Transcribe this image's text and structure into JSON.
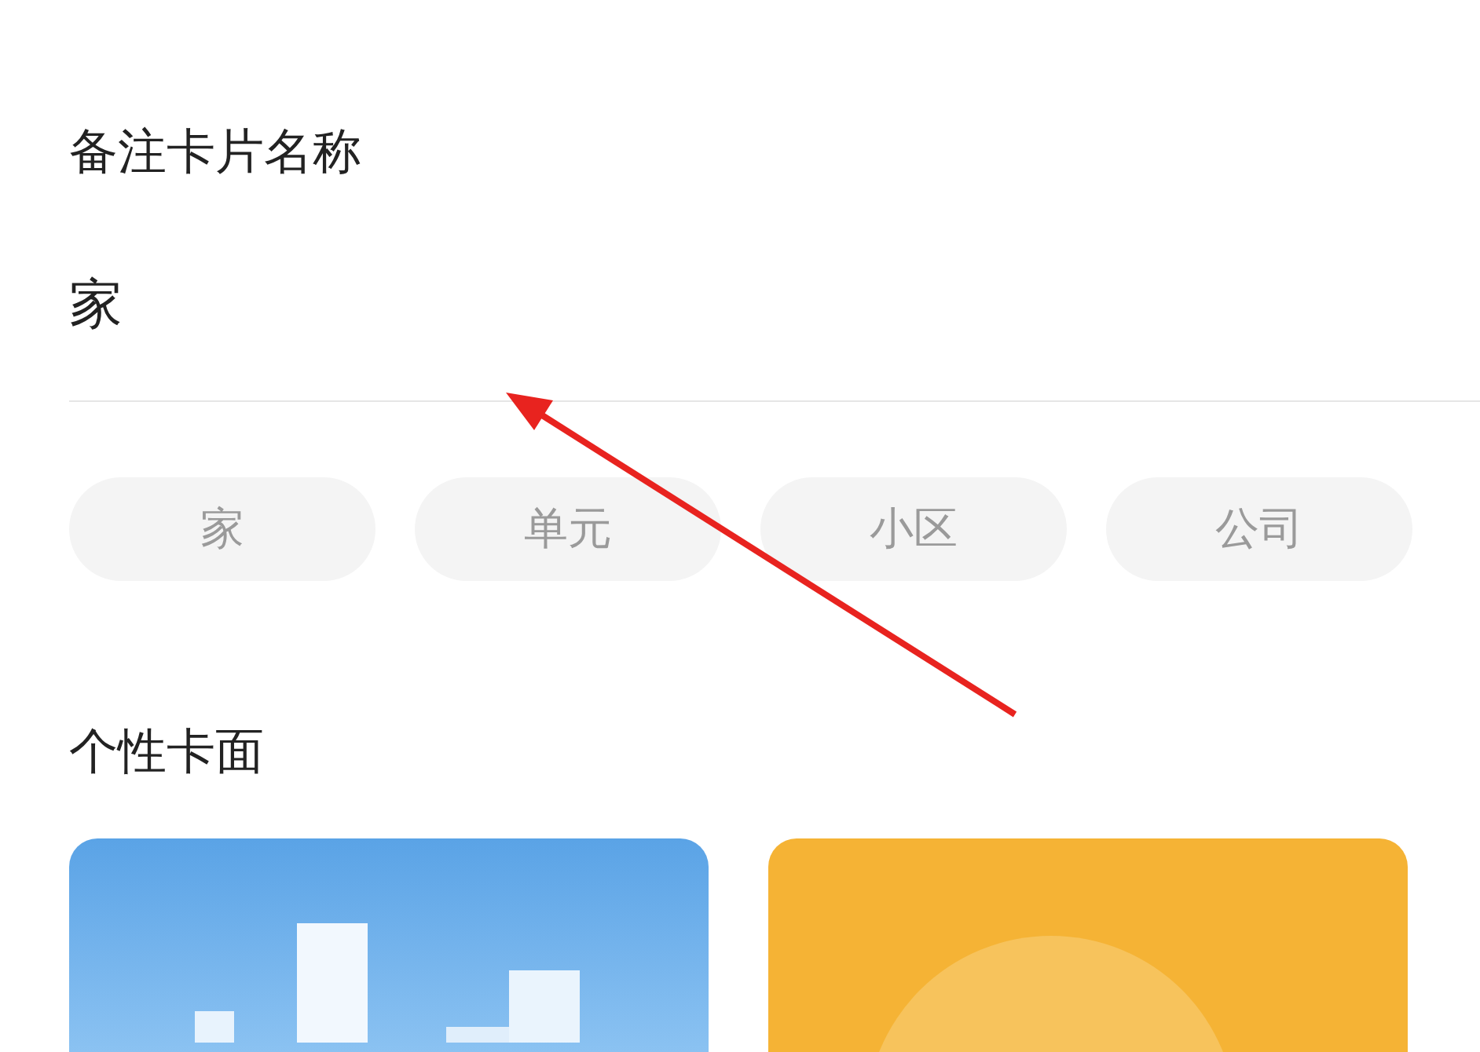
{
  "name_section": {
    "title": "备注卡片名称",
    "value": "家"
  },
  "suggestions": [
    "家",
    "单元",
    "小区",
    "公司"
  ],
  "card_faces": {
    "title": "个性卡面",
    "cards": [
      {
        "kind": "city"
      },
      {
        "kind": "sun"
      }
    ]
  }
}
